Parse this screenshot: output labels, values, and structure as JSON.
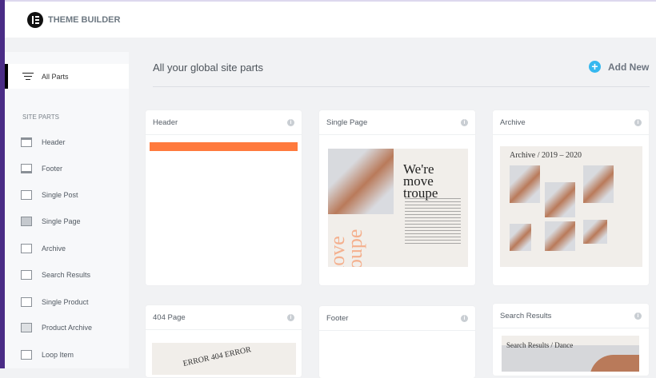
{
  "app": {
    "title": "THEME BUILDER"
  },
  "sidebar": {
    "all_parts": "All Parts",
    "section_title": "SITE PARTS",
    "items": [
      {
        "label": "Header",
        "icon": "header-icon"
      },
      {
        "label": "Footer",
        "icon": "footer-icon"
      },
      {
        "label": "Single Post",
        "icon": "single-post-icon"
      },
      {
        "label": "Single Page",
        "icon": "single-page-icon"
      },
      {
        "label": "Archive",
        "icon": "archive-icon"
      },
      {
        "label": "Search Results",
        "icon": "search-results-icon"
      },
      {
        "label": "Single Product",
        "icon": "single-product-icon"
      },
      {
        "label": "Product Archive",
        "icon": "product-archive-icon"
      },
      {
        "label": "Loop Item",
        "icon": "loop-item-icon"
      }
    ]
  },
  "main": {
    "heading": "All your global site parts",
    "add_new": "Add New",
    "cards": [
      {
        "title": "Header"
      },
      {
        "title": "Single Page",
        "preview_title": "We're move troupe",
        "preview_side": "move troupe"
      },
      {
        "title": "Archive",
        "preview_title": "Archive / 2019 – 2020"
      },
      {
        "title": "404 Page",
        "preview_title": "ERROR 404 ERROR"
      },
      {
        "title": "Footer"
      },
      {
        "title": "Search Results",
        "preview_title": "Search Results / Dance"
      }
    ]
  },
  "colors": {
    "accent": "#36b8ef",
    "sidebar_bar": "#4a2c86",
    "header_preview": "#ff7a3d"
  }
}
